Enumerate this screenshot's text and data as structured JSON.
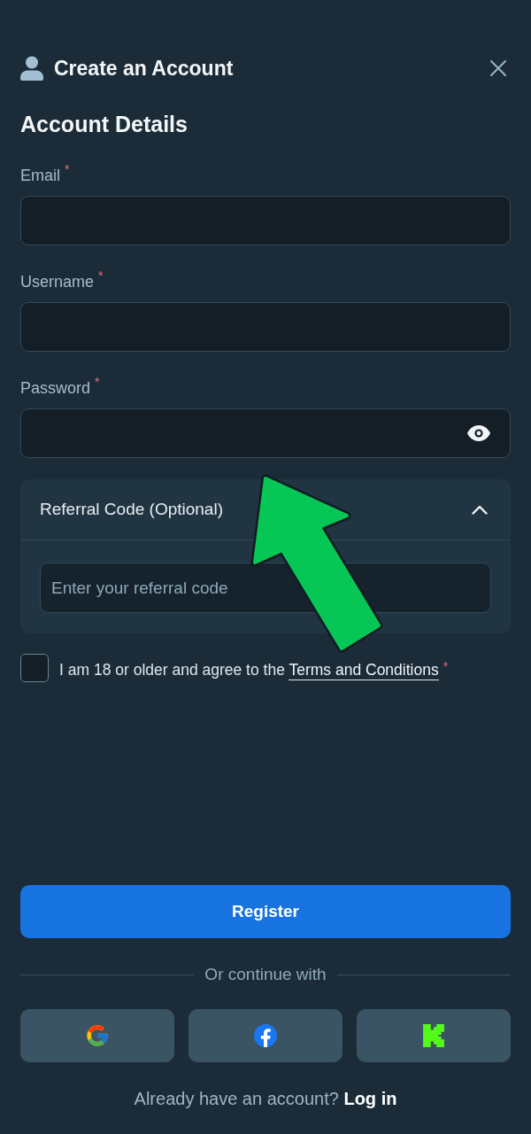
{
  "header": {
    "title": "Create an Account"
  },
  "section_title": "Account Details",
  "fields": [
    {
      "label": "Email",
      "required_mark": "*",
      "kind": "text"
    },
    {
      "label": "Username",
      "required_mark": "*",
      "kind": "text"
    },
    {
      "label": "Password",
      "required_mark": "*",
      "kind": "password"
    }
  ],
  "referral": {
    "title": "Referral Code (Optional)",
    "expanded": true,
    "placeholder": "Enter your referral code"
  },
  "agreement": {
    "checked": false,
    "text": "I am 18 or older and agree to the",
    "link": "Terms and Conditions",
    "required_mark": "*"
  },
  "register_button": "Register",
  "divider_text": "Or continue with",
  "social_buttons": [
    {
      "kind": "google"
    },
    {
      "kind": "facebook"
    },
    {
      "kind": "kick"
    }
  ],
  "footer": {
    "text": "Already have an account?",
    "link": "Log in"
  }
}
